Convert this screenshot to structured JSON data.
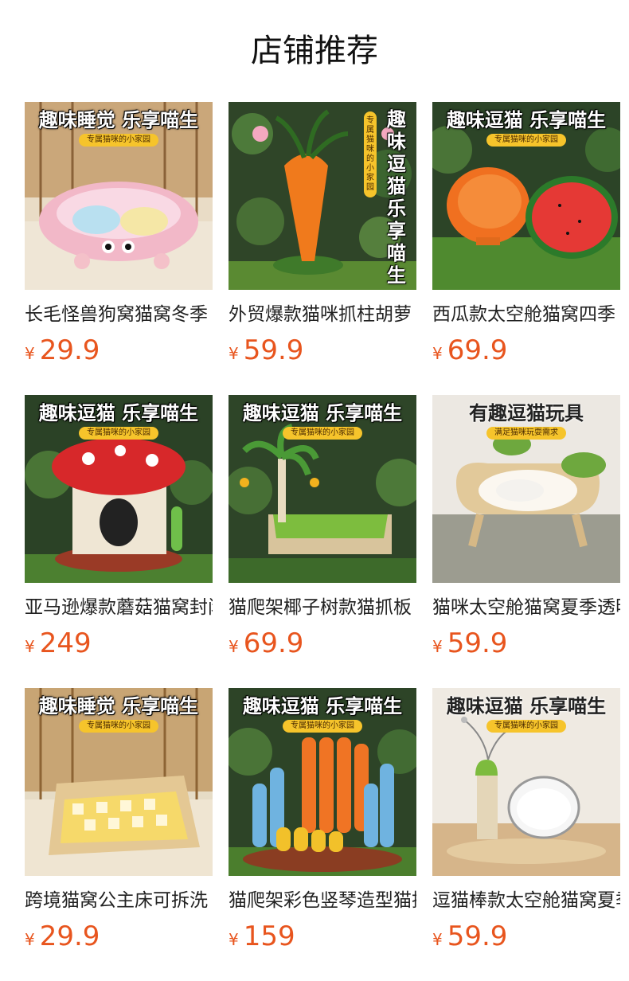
{
  "section": {
    "title": "店铺推荐"
  },
  "currency_symbol": "¥",
  "colors": {
    "price": "#e8551e",
    "pill": "#f6c42b"
  },
  "products": [
    {
      "name": "长毛怪兽狗窝猫窝冬季",
      "price": "29.9",
      "banner": "趣味睡觉 乐享喵生",
      "pill": "专属猫咪的小家园",
      "image_subject": "plush-monster-pet-bed"
    },
    {
      "name": "外贸爆款猫咪抓柱胡萝卜",
      "price": "59.9",
      "banner": "趣味逗猫乐享喵生",
      "pill": "专属猫咪的小家园",
      "image_subject": "carrot-cat-scratching-post"
    },
    {
      "name": "西瓜款太空舱猫窝四季",
      "price": "69.9",
      "banner": "趣味逗猫 乐享喵生",
      "pill": "专属猫咪的小家园",
      "image_subject": "watermelon-space-capsule-cat-bed"
    },
    {
      "name": "亚马逊爆款蘑菇猫窝封闭",
      "price": "249",
      "banner": "趣味逗猫 乐享喵生",
      "pill": "专属猫咪的小家园",
      "image_subject": "mushroom-cat-house"
    },
    {
      "name": "猫爬架椰子树款猫抓板",
      "price": "69.9",
      "banner": "趣味逗猫 乐享喵生",
      "pill": "专属猫咪的小家园",
      "image_subject": "coconut-tree-cat-tree"
    },
    {
      "name": "猫咪太空舱猫窝夏季透明",
      "price": "59.9",
      "banner": "有趣逗猫玩具",
      "pill": "满足猫咪玩耍需求",
      "image_subject": "cloud-space-capsule-cat-bed"
    },
    {
      "name": "跨境猫窝公主床可拆洗",
      "price": "29.9",
      "banner": "趣味睡觉 乐享喵生",
      "pill": "专属猫咪的小家园",
      "image_subject": "princess-wooden-cat-bed"
    },
    {
      "name": "猫爬架彩色竖琴造型猫抓",
      "price": "159",
      "banner": "趣味逗猫 乐享喵生",
      "pill": "专属猫咪的小家园",
      "image_subject": "colorful-harp-cat-scratcher"
    },
    {
      "name": "逗猫棒款太空舱猫窝夏季",
      "price": "59.9",
      "banner": "趣味逗猫 乐享喵生",
      "pill": "专属猫咪的小家园",
      "image_subject": "teaser-wand-space-capsule-cat-bed"
    }
  ]
}
